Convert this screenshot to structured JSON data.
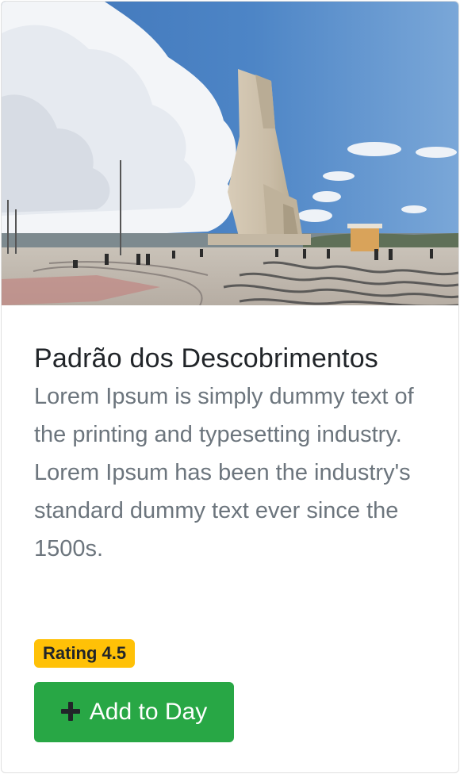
{
  "card": {
    "image": {
      "alt": "Padrão dos Descobrimentos monument in Lisbon"
    },
    "title": "Padrão dos Descobrimentos",
    "description": "Lorem Ipsum is simply dummy text of the printing and typesetting industry. Lorem Ipsum has been the industry's standard dummy text ever since the 1500s.",
    "rating_badge": "Rating 4.5",
    "add_button": {
      "label": "Add to Day",
      "icon": "plus-icon"
    }
  },
  "colors": {
    "badge_background": "#ffc107",
    "button_background": "#28a745",
    "title_text": "#212529",
    "description_text": "#6c757d"
  }
}
